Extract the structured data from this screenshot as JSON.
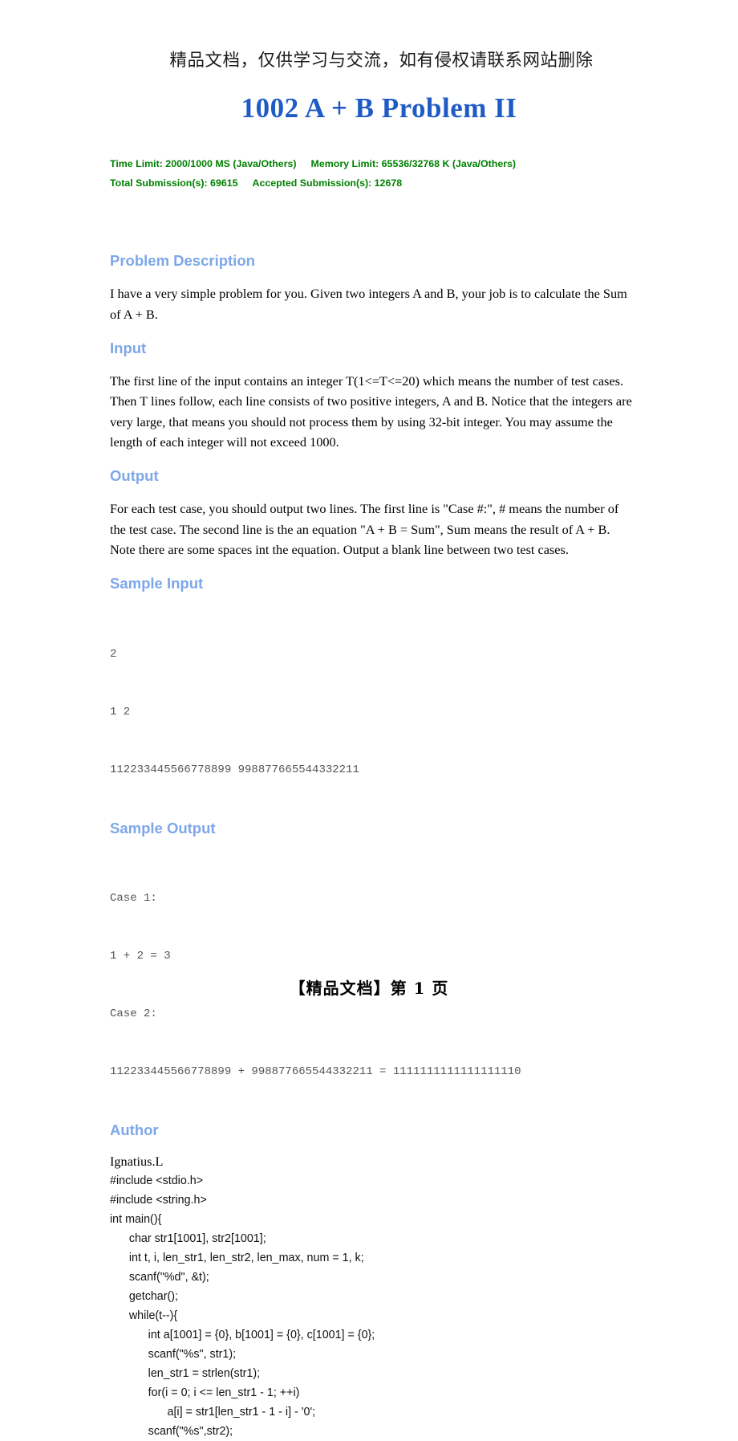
{
  "notice": "精品文档，仅供学习与交流，如有侵权请联系网站删除",
  "title": "1002 A + B Problem II",
  "meta": {
    "time_limit": "Time Limit: 2000/1000 MS (Java/Others)",
    "memory_limit": "Memory Limit: 65536/32768 K (Java/Others)",
    "total_submissions": "Total Submission(s): 69615",
    "accepted_submissions": "Accepted Submission(s): 12678"
  },
  "sections": {
    "problem_description": {
      "heading": "Problem Description",
      "body": "I have a very simple problem for you. Given two integers A and B, your job is to calculate the Sum of A + B."
    },
    "input": {
      "heading": "Input",
      "body": "The first line of the input contains an integer T(1<=T<=20) which means the number of test cases. Then T lines follow, each line consists of two positive integers, A and B. Notice that the integers are very large, that means you should not process them by using 32-bit integer. You may assume the length of each integer will not exceed 1000."
    },
    "output": {
      "heading": "Output",
      "body": "For each test case, you should output two lines. The first line is \"Case #:\", # means the number of the test case. The second line is the an equation \"A + B = Sum\", Sum means the result of A + B. Note there are some spaces int the equation. Output a blank line between two test cases."
    },
    "sample_input": {
      "heading": "Sample Input",
      "lines": [
        "2",
        "1 2",
        "112233445566778899 998877665544332211"
      ]
    },
    "sample_output": {
      "heading": "Sample Output",
      "lines": [
        "Case 1:",
        "1 + 2 = 3",
        "Case 2:",
        "112233445566778899 + 998877665544332211 = 1111111111111111110"
      ]
    },
    "author": {
      "heading": "Author",
      "name": "Ignatius.L"
    }
  },
  "code": {
    "lines": [
      "#include <stdio.h>",
      "#include <string.h>",
      "int main(){",
      "      char str1[1001], str2[1001];",
      "      int t, i, len_str1, len_str2, len_max, num = 1, k;",
      "      scanf(\"%d\", &t);",
      "      getchar();",
      "      while(t--){",
      "            int a[1001] = {0}, b[1001] = {0}, c[1001] = {0};",
      "            scanf(\"%s\", str1);",
      "            len_str1 = strlen(str1);",
      "            for(i = 0; i <= len_str1 - 1; ++i)",
      "                  a[i] = str1[len_str1 - 1 - i] - '0';",
      "            scanf(\"%s\",str2);"
    ]
  },
  "footer": "【精品文档】第 1 页"
}
